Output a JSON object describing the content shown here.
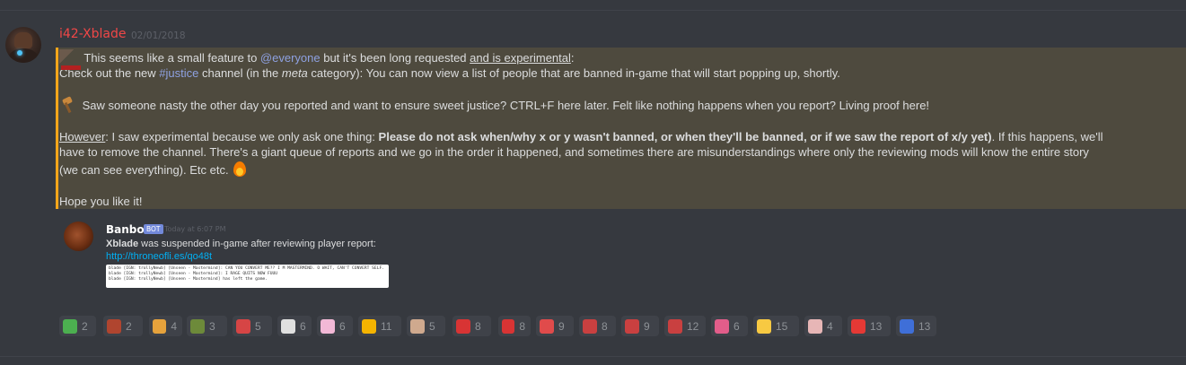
{
  "message": {
    "author": "i42-Xblade",
    "timestamp": "02/01/2018",
    "line1_pre": "This seems like a small feature to ",
    "line1_mention": "@everyone",
    "line1_mid": " but it's been long requested ",
    "line1_underline": "and is experimental",
    "line1_post": ":",
    "line2_pre": "Check out the new ",
    "line2_channel": "#justice",
    "line2_mid": " channel (in the ",
    "line2_italic": "meta",
    "line2_post": " category): You can now view a list of people that are banned in-game that will start popping up, shortly.",
    "line3": "Saw someone nasty the other day you reported and want to ensure sweet justice? CTRL+F here later. Felt like nothing happens when you report? Living proof here!",
    "line4_underline": "However",
    "line4_mid": ": I saw experimental because we only ask one thing: ",
    "line4_bold": "Please do not ask when/why x or y wasn't banned, or when they'll be banned, or if we saw the report of x/y yet)",
    "line4_post": ". If this happens, we'll",
    "line5": "have to remove the channel. There's a giant queue of reports and we go in the order it happened, and sometimes there are misunderstandings where only the reviewing mods will know the entire story",
    "line6": "(we can see everything). Etc etc.",
    "line7": "Hope you like it!"
  },
  "embed": {
    "author": "Banbot",
    "tag": "BOT",
    "timestamp": "Today at 6:07 PM",
    "text_bold": "Xblade",
    "text_rest": " was suspended in-game after reviewing player report:",
    "link": "http://throneofli.es/qo48t",
    "log_lines": [
      "blade [IGN: trollyNewb] [Unseen - Mastermind]: CAN YOU CONVERT ME?? I M MASTERMIND. O WAIT, CAN'T CONVERT SELF.",
      "blade [IGN: trollyNewb] [Unseen - Mastermind]: I RAGE QUITS NOW FUUU",
      "blade [IGN: trollyNewb] [Unseen - Mastermind] has left the game."
    ]
  },
  "reactions": [
    {
      "icon": "frog-emoji",
      "count": "2",
      "color": "#4caf50"
    },
    {
      "icon": "swords-emoji",
      "count": "2",
      "color": "#b0452f"
    },
    {
      "icon": "character-emoji",
      "count": "4",
      "color": "#e6a23c"
    },
    {
      "icon": "gun-emoji",
      "count": "3",
      "color": "#6d8a3a"
    },
    {
      "icon": "skull-emoji",
      "count": "5",
      "color": "#d64545"
    },
    {
      "icon": "panda-emoji",
      "count": "6",
      "color": "#e0e0e0"
    },
    {
      "icon": "anime-emoji",
      "count": "6",
      "color": "#f2b8d6"
    },
    {
      "icon": "zipper-emoji",
      "count": "11",
      "color": "#f5b400"
    },
    {
      "icon": "girl-emoji",
      "count": "5",
      "color": "#cfa98e"
    },
    {
      "icon": "fish-red-emoji",
      "count": "8",
      "color": "#d83434"
    },
    {
      "icon": "fish-red2-emoji",
      "count": "8",
      "color": "#d83434"
    },
    {
      "icon": "lips-emoji",
      "count": "9",
      "color": "#e04b4b"
    },
    {
      "icon": "fish-number-emoji",
      "count": "8",
      "color": "#c94040"
    },
    {
      "icon": "fish-num2-emoji",
      "count": "9",
      "color": "#c94040"
    },
    {
      "icon": "fish-emoji",
      "count": "12",
      "color": "#c94040"
    },
    {
      "icon": "flower-emoji",
      "count": "6",
      "color": "#e25d8a"
    },
    {
      "icon": "crown-emoji",
      "count": "15",
      "color": "#f7c942"
    },
    {
      "icon": "girl2-emoji",
      "count": "4",
      "color": "#e7b6b6"
    },
    {
      "icon": "number-one-emoji",
      "count": "13",
      "color": "#e53935"
    },
    {
      "icon": "penguin-emoji",
      "count": "13",
      "color": "#3f6fd8"
    }
  ]
}
